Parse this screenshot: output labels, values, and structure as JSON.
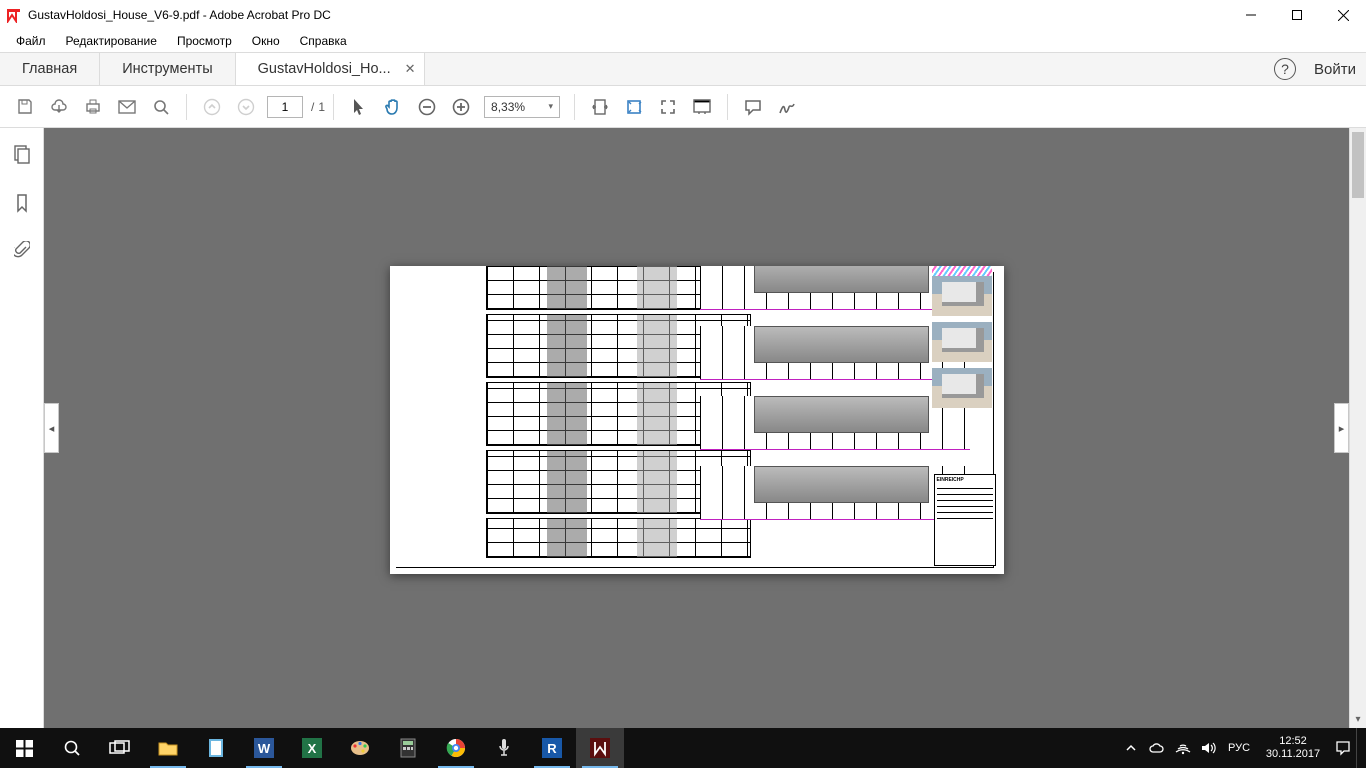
{
  "window": {
    "title": "GustavHoldosi_House_V6-9.pdf - Adobe Acrobat Pro DC"
  },
  "menu": [
    "Файл",
    "Редактирование",
    "Просмотр",
    "Окно",
    "Справка"
  ],
  "tabs": {
    "home": "Главная",
    "tools": "Инструменты",
    "doc": "GustavHoldosi_Ho...",
    "signin": "Войти"
  },
  "toolbar": {
    "page_current": "1",
    "page_sep": "/",
    "page_total": "1",
    "zoom": "8,33%"
  },
  "document": {
    "titleblock_heading": "EINREICHP"
  },
  "systray": {
    "lang": "РУС",
    "time": "12:52",
    "date": "30.11.2017"
  }
}
